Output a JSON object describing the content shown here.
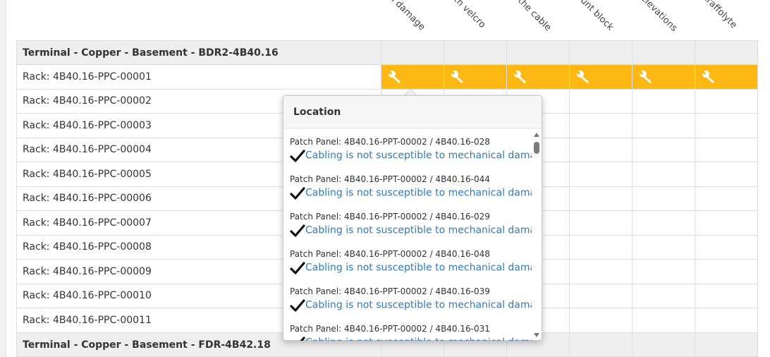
{
  "columns": [
    {
      "label": "cal damage"
    },
    {
      "label": "with velcro"
    },
    {
      "label": "of the cable"
    },
    {
      "label": "nount block"
    },
    {
      "label": "c elevations"
    },
    {
      "label": "a traffolyte"
    }
  ],
  "groups": [
    {
      "title": "Terminal - Copper - Basement - BDR2-4B40.16",
      "racks": [
        {
          "label": "Rack: 4B40.16-PPC-00001",
          "status": [
            "warning",
            "warning",
            "warning",
            "warning",
            "warning",
            "warning"
          ]
        },
        {
          "label": "Rack: 4B40.16-PPC-00002",
          "status": []
        },
        {
          "label": "Rack: 4B40.16-PPC-00003",
          "status": []
        },
        {
          "label": "Rack: 4B40.16-PPC-00004",
          "status": []
        },
        {
          "label": "Rack: 4B40.16-PPC-00005",
          "status": []
        },
        {
          "label": "Rack: 4B40.16-PPC-00006",
          "status": []
        },
        {
          "label": "Rack: 4B40.16-PPC-00007",
          "status": []
        },
        {
          "label": "Rack: 4B40.16-PPC-00008",
          "status": []
        },
        {
          "label": "Rack: 4B40.16-PPC-00009",
          "status": []
        },
        {
          "label": "Rack: 4B40.16-PPC-00010",
          "status": []
        },
        {
          "label": "Rack: 4B40.16-PPC-00011",
          "status": []
        }
      ]
    },
    {
      "title": "Terminal - Copper - Basement - FDR-4B42.18",
      "racks": []
    }
  ],
  "popover": {
    "title": "Location",
    "entries": [
      {
        "location": "Patch Panel: 4B40.16-PPT-00002 / 4B40.16-028",
        "status": "Cabling is not susceptible to mechanical damage."
      },
      {
        "location": "Patch Panel: 4B40.16-PPT-00002 / 4B40.16-044",
        "status": "Cabling is not susceptible to mechanical damage."
      },
      {
        "location": "Patch Panel: 4B40.16-PPT-00002 / 4B40.16-029",
        "status": "Cabling is not susceptible to mechanical damage."
      },
      {
        "location": "Patch Panel: 4B40.16-PPT-00002 / 4B40.16-048",
        "status": "Cabling is not susceptible to mechanical damage."
      },
      {
        "location": "Patch Panel: 4B40.16-PPT-00002 / 4B40.16-039",
        "status": "Cabling is not susceptible to mechanical damage."
      },
      {
        "location": "Patch Panel: 4B40.16-PPT-00002 / 4B40.16-031",
        "status": "Cabling is not susceptible to mechanical damage."
      }
    ]
  },
  "colors": {
    "warning_fill": "#fdb813",
    "link_blue": "#2f7bc1",
    "group_bg": "#eeeeee"
  },
  "icons": {
    "warning_cell": "wrench-icon",
    "ok_mark": "check-icon"
  }
}
